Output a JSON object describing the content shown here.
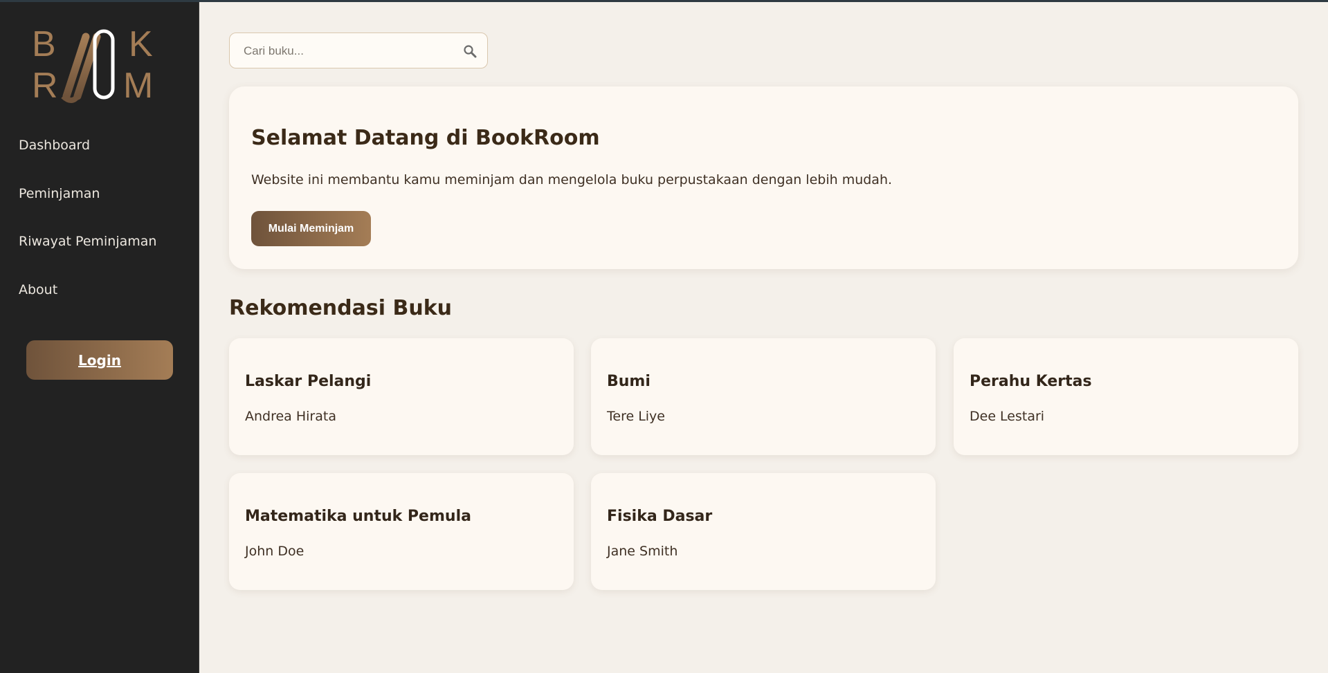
{
  "brand": {
    "logo_text": "BOOKROOM",
    "colors": {
      "bronze": "#a47d56",
      "dark_bronze": "#6f533b",
      "white": "#ffffff"
    }
  },
  "sidebar": {
    "items": [
      {
        "label": "Dashboard"
      },
      {
        "label": "Peminjaman"
      },
      {
        "label": "Riwayat Peminjaman"
      },
      {
        "label": "About"
      }
    ],
    "login_label": "Login"
  },
  "search": {
    "placeholder": "Cari buku...",
    "value": "",
    "icon": "search-icon"
  },
  "hero": {
    "title": "Selamat Datang di BookRoom",
    "text": "Website ini membantu kamu meminjam dan mengelola buku perpustakaan dengan lebih mudah.",
    "button_label": "Mulai Meminjam"
  },
  "recommendations": {
    "title": "Rekomendasi Buku",
    "books": [
      {
        "title": "Laskar Pelangi",
        "author": "Andrea Hirata"
      },
      {
        "title": "Bumi",
        "author": "Tere Liye"
      },
      {
        "title": "Perahu Kertas",
        "author": "Dee Lestari"
      },
      {
        "title": "Matematika untuk Pemula",
        "author": "John Doe"
      },
      {
        "title": "Fisika Dasar",
        "author": "Jane Smith"
      }
    ]
  },
  "theme": {
    "sidebar_bg": "#222222",
    "page_bg": "#f4f0ea",
    "card_bg": "#fdf8f2",
    "heading_color": "#3b2a18"
  }
}
